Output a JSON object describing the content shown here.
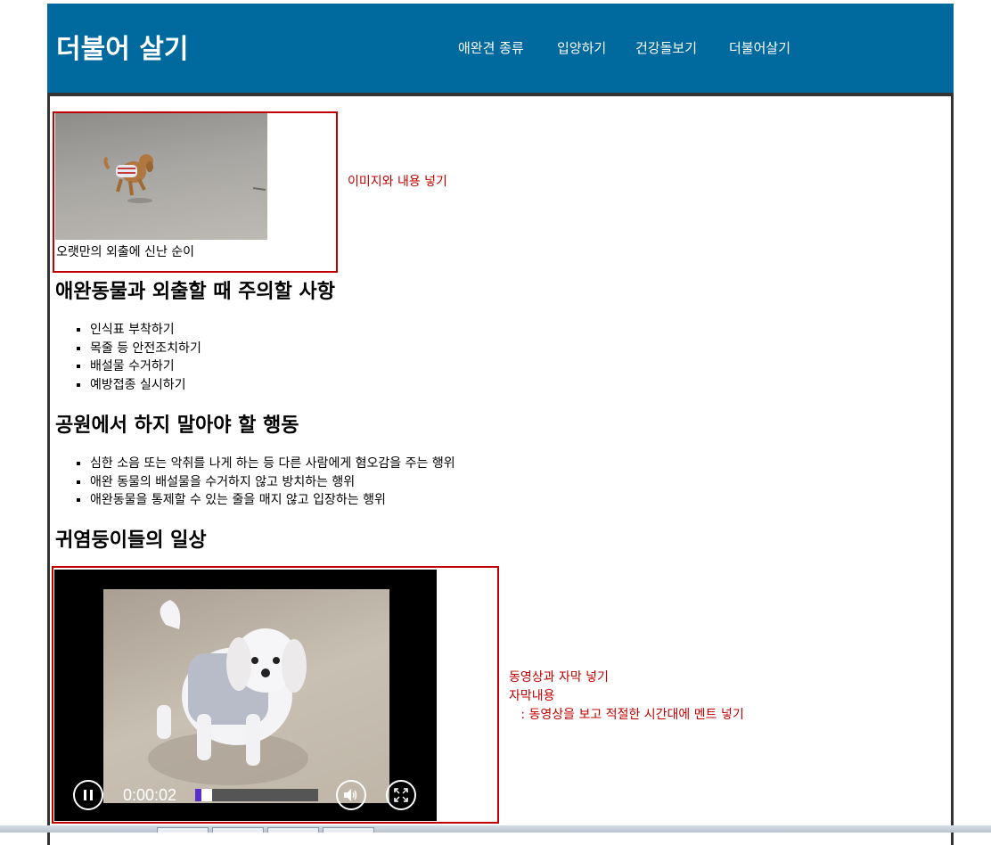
{
  "header": {
    "title": "더불어 살기",
    "nav": [
      "애완견 종류",
      "입양하기",
      "건강돌보기",
      "더불어살기"
    ],
    "background": "#00699d"
  },
  "figure": {
    "caption": "오랫만의 외출에 신난 순이",
    "note": "이미지와 내용 넣기"
  },
  "section1": {
    "heading": "애완동물과 외출할 때 주의할 사항",
    "items": [
      "인식표 부착하기",
      "목줄 등 안전조치하기",
      "배설물 수거하기",
      "예방접종 실시하기"
    ]
  },
  "section2": {
    "heading": "공원에서 하지 말아야 할 행동",
    "items": [
      "심한 소음 또는 악취를 나게 하는 등 다른 사람에게 혐오감을 주는 행위",
      "애완 동물의 배설물을 수거하지 않고 방치하는 행위",
      "애완동물을 통제할 수 있는 줄을 매지 않고 입장하는 행위"
    ]
  },
  "section3": {
    "heading": "귀염둥이들의 일상"
  },
  "video": {
    "time": "0:00:02",
    "progress": 0.05,
    "icons": [
      "pause-icon",
      "volume-icon",
      "fullscreen-icon"
    ]
  },
  "video_note": {
    "line1": "동영상과 자막 넣기",
    "line2": "자막내용",
    "line3": "   : 동영상을 보고 적절한 시간대에 멘트 넣기"
  },
  "colors": {
    "annotation": "#c00000",
    "progress": "#5a2ec8"
  }
}
